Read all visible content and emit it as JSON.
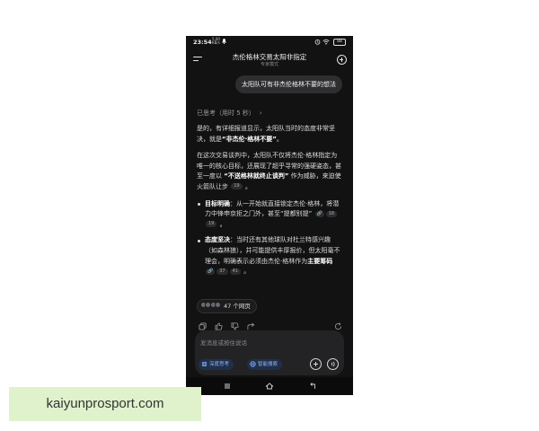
{
  "status_bar": {
    "time": "23:54",
    "net_speed_top": "5.00",
    "net_speed_bottom": "KB/s",
    "battery": "88",
    "icons": [
      "bell-icon",
      "alarm-icon",
      "wifi-icon",
      "battery-icon"
    ]
  },
  "header": {
    "title": "杰伦格林交易太阳非指定",
    "subtitle": "专家模式",
    "icons": [
      "hamburger-menu-icon",
      "new-chat-icon"
    ]
  },
  "user_message": "太阳队可有非杰伦格林不要的想法",
  "thought": {
    "label": "已思考（用时 5 秒）",
    "chevron": "›"
  },
  "answer": {
    "p1_a": "是的，有详细报道显示，太阳队当时的态度非常坚决，就是",
    "p1_bold": "“非杰伦·格林不要”",
    "p1_b": "。",
    "p2_a": "在这次交易谈判中，太阳队不仅将杰伦·格林指定为唯一的核心目标，还展现了超乎寻常的强硬姿态，甚至一度以 ",
    "p2_bold": "“不送格林就终止谈判”",
    "p2_b": " 作为威胁，来迫使火箭队让步",
    "p2_cite": "19",
    "b1_bold": "目标明确",
    "b1_a": "：从一开始就直接锁定杰伦·格林，将潜力中锋申京拒之门外，甚至“提都别提”",
    "b1_cite1": "18",
    "b1_cite2": "19",
    "b2_bold": "态度坚决",
    "b2_a": "：当时还有其他球队对杜兰特感兴趣（如森林狼），并可能提供丰厚报价，但太阳毫不理会，明确表示必须由杰伦·格林作为",
    "b2_bold2": "主要筹码",
    "b2_cite1": "37",
    "b2_cite2": "41",
    "period": "。"
  },
  "sources": {
    "label": "47 个网页"
  },
  "actions": [
    "copy-icon",
    "like-icon",
    "dislike-icon",
    "share-icon",
    "regenerate-icon"
  ],
  "composer": {
    "placeholder": "发消息或按住说话",
    "chip_deep": "深度思考",
    "chip_search": "智能搜索"
  },
  "watermark": "kaiyunprosport.com",
  "colors": {
    "background": "#121212",
    "bubble": "#2e2e30",
    "chip_bg": "#20304a",
    "chip_text": "#8fb4ff",
    "watermark_bg": "#dff2cc"
  }
}
